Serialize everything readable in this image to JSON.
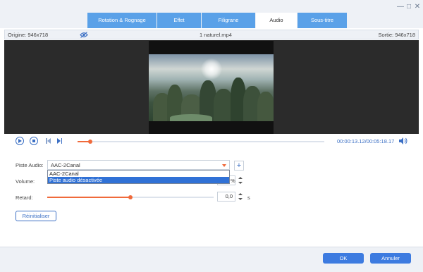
{
  "window": {
    "minimize_icon": "minimize-icon",
    "close_icon": "close-icon"
  },
  "tabs": [
    {
      "label": "Rotation & Rognage",
      "active": false
    },
    {
      "label": "Effet",
      "active": false
    },
    {
      "label": "Filigrane",
      "active": false
    },
    {
      "label": "Audio",
      "active": true
    },
    {
      "label": "Sous-titre",
      "active": false
    }
  ],
  "infobar": {
    "origin": "Origine: 946x718",
    "filename": "1 naturel.mp4",
    "output": "Sortie: 946x718",
    "eye_icon": "eye-icon"
  },
  "player": {
    "current_time": "00:00:13.12",
    "total_time": "/00:05:18.17",
    "progress": 0.05
  },
  "audio": {
    "track_label": "Piste Audio:",
    "track_value": "AAC-2Canal",
    "dropdown_options": [
      "AAC-2Canal",
      "Piste audio désactivée"
    ],
    "dropdown_selected_index": 1,
    "volume_label": "Volume:",
    "volume_unit": "%",
    "delay_label": "Retard:",
    "delay_value": "0,0",
    "delay_unit": "s",
    "delay_slider_fraction": 0.5
  },
  "buttons": {
    "reset": "Réinitialiser",
    "ok": "OK",
    "cancel": "Annuler"
  },
  "colors": {
    "accent": "#3d7be0",
    "orange": "#f06a3b",
    "tab_bar": "#5aa1e8"
  }
}
